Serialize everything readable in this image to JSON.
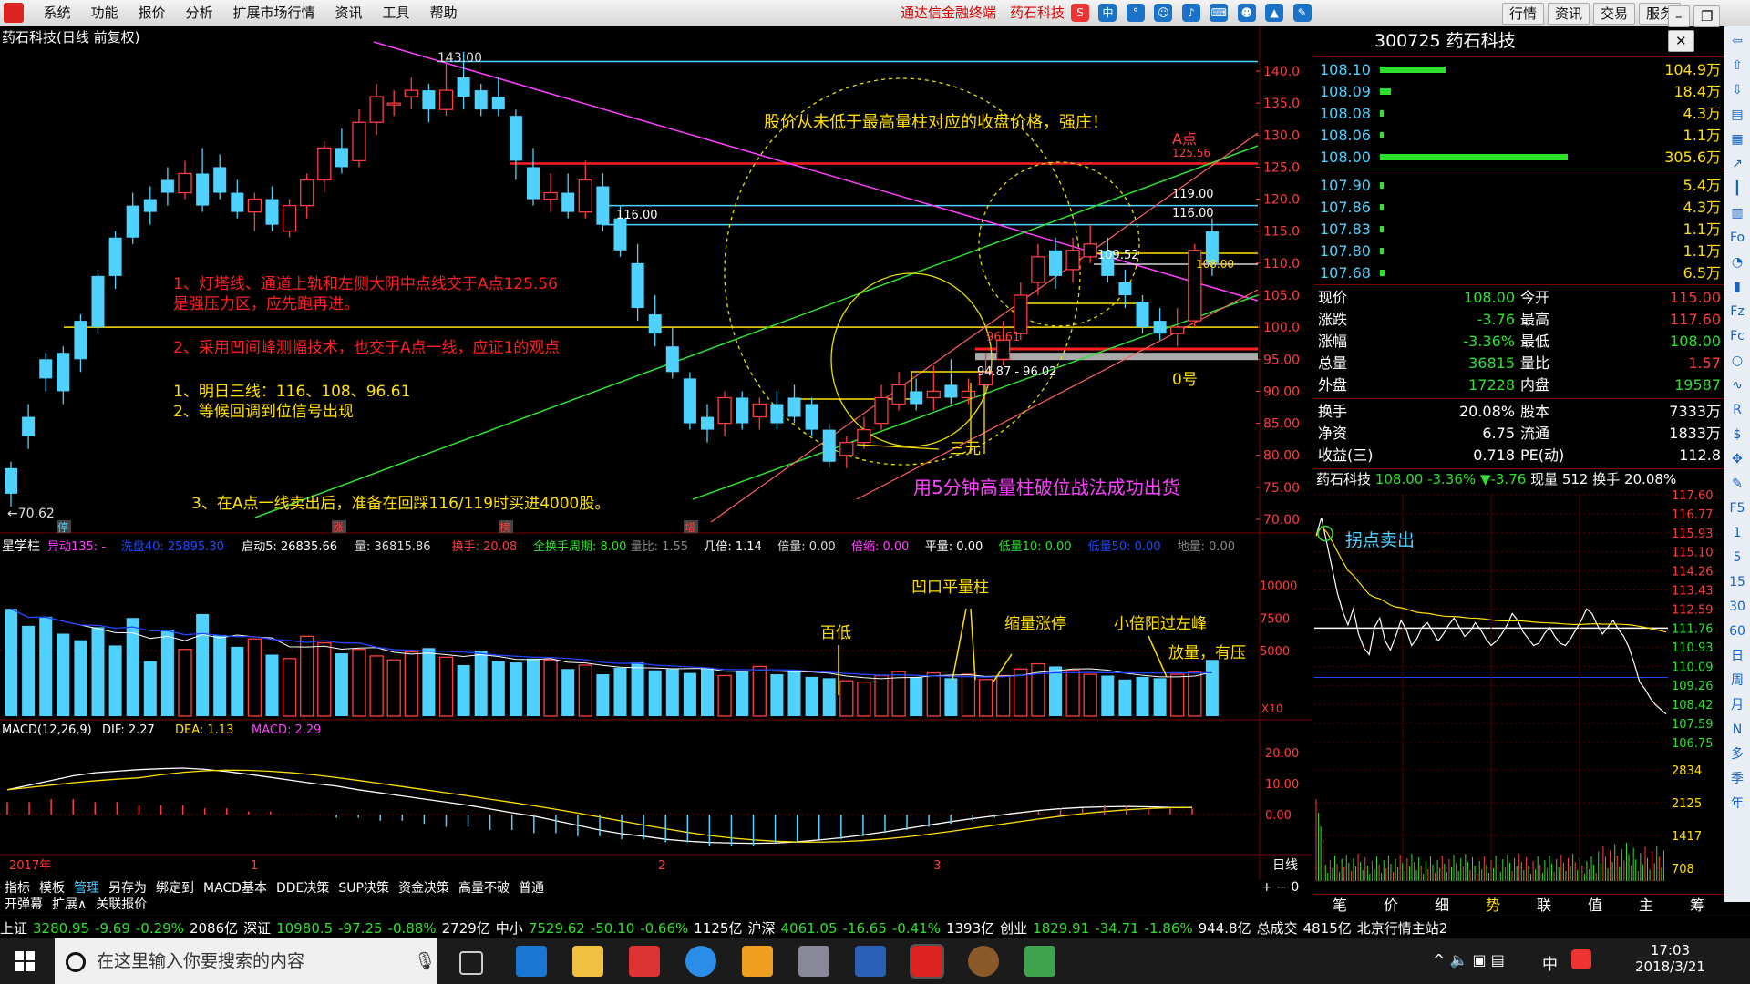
{
  "menu": {
    "items": [
      "系统",
      "功能",
      "报价",
      "分析",
      "扩展市场行情",
      "资讯",
      "工具",
      "帮助"
    ],
    "brand": "通达信金融终端",
    "stock_name": "药石科技",
    "right_buttons": [
      "行情",
      "资讯",
      "交易",
      "服务"
    ]
  },
  "chart": {
    "title": "药石科技(日线 前复权)",
    "price_axis": [
      "140.0",
      "135.0",
      "130.0",
      "125.0",
      "120.0",
      "115.0",
      "110.0",
      "105.0",
      "100.0",
      "95.00",
      "90.00",
      "85.00",
      "80.00",
      "75.00",
      "70.00"
    ],
    "high_label": "143.00",
    "low_label": "70.62",
    "level_116_left": "116.00",
    "level_a": "A点",
    "level_12556": "125.56",
    "level_119": "119.00",
    "level_116_right": "116.00",
    "level_10952": "109.52",
    "level_108": "108.00",
    "level_9661": "96.61",
    "range_label": "94.87 - 96.02",
    "label_zero": "0号",
    "label_sanyuan": "三元",
    "note_top": "股价从未低于最高量柱对应的收盘价格，强庄！",
    "note_red1a": "1、灯塔线、通道上轨和左侧大阴中点线交于A点125.56",
    "note_red1b": "是强压力区，应先跑再进。",
    "note_red2": "2、采用凹间峰测幅技术，也交于A点一线，应证1的观点",
    "note_y1": "1、明日三线：116、108、96.61",
    "note_y2": "2、等候回调到位信号出现",
    "note_y3": "3、在A点一线卖出后，准备在回踩116/119时买进4000股。",
    "note_magenta": "用5分钟高量柱破位战法成功出货",
    "marks": [
      "停",
      "涨",
      "榜",
      "增"
    ],
    "candles": [
      [
        1,
        78,
        74,
        72,
        79
      ],
      [
        2,
        86,
        83,
        81,
        88
      ],
      [
        3,
        95,
        92,
        90,
        96
      ],
      [
        4,
        96,
        90,
        88,
        97
      ],
      [
        5,
        101,
        95,
        93,
        102
      ],
      [
        6,
        108,
        100,
        99,
        109
      ],
      [
        7,
        114,
        108,
        106,
        115
      ],
      [
        8,
        119,
        114,
        113,
        121
      ],
      [
        9,
        120,
        118,
        116,
        122
      ],
      [
        10,
        123,
        121,
        119,
        125
      ],
      [
        11,
        121,
        124,
        120,
        126
      ],
      [
        12,
        124,
        119,
        118,
        128
      ],
      [
        13,
        125,
        121,
        120,
        127
      ],
      [
        14,
        121,
        118,
        117,
        123
      ],
      [
        15,
        118,
        120,
        115,
        121
      ],
      [
        16,
        120,
        116,
        115,
        122
      ],
      [
        17,
        115,
        119,
        114,
        120
      ],
      [
        18,
        119,
        123,
        117,
        124
      ],
      [
        19,
        123,
        128,
        121,
        129
      ],
      [
        20,
        128,
        125,
        124,
        131
      ],
      [
        21,
        126,
        132,
        125,
        134
      ],
      [
        22,
        132,
        136,
        130,
        138
      ],
      [
        23,
        135,
        135,
        133,
        137
      ],
      [
        24,
        136,
        137,
        134,
        139
      ],
      [
        25,
        137,
        134,
        132,
        138
      ],
      [
        26,
        134,
        137,
        133,
        142
      ],
      [
        27,
        139,
        136,
        134,
        143
      ],
      [
        28,
        137,
        134,
        133,
        138
      ],
      [
        29,
        136,
        134,
        133,
        139
      ],
      [
        30,
        133,
        126,
        123,
        134
      ],
      [
        31,
        125,
        120,
        119,
        128
      ],
      [
        32,
        120,
        121,
        118,
        124
      ],
      [
        33,
        121,
        118,
        117,
        124
      ],
      [
        34,
        118,
        123,
        117,
        126
      ],
      [
        35,
        122,
        116,
        115,
        124
      ],
      [
        36,
        117,
        112,
        111,
        119
      ],
      [
        37,
        110,
        103,
        101,
        113
      ],
      [
        38,
        102,
        99,
        97,
        105
      ],
      [
        39,
        97,
        93,
        92,
        100
      ],
      [
        40,
        92,
        85,
        84,
        93
      ],
      [
        41,
        86,
        84,
        82,
        88
      ],
      [
        42,
        85,
        89,
        83,
        90
      ],
      [
        43,
        89,
        85,
        84,
        90
      ],
      [
        44,
        86,
        88,
        84,
        89
      ],
      [
        45,
        88,
        85,
        84,
        90
      ],
      [
        46,
        89,
        86,
        85,
        91
      ],
      [
        47,
        88,
        84,
        83,
        89
      ],
      [
        48,
        84,
        79,
        78,
        85
      ],
      [
        49,
        80,
        82,
        78,
        83
      ],
      [
        50,
        82,
        84,
        81,
        86
      ],
      [
        51,
        85,
        89,
        84,
        91
      ],
      [
        52,
        88,
        91,
        87,
        93
      ],
      [
        53,
        90,
        88,
        87,
        92
      ],
      [
        54,
        89,
        90,
        87,
        94
      ],
      [
        55,
        91,
        89,
        88,
        95
      ],
      [
        56,
        89,
        90,
        88,
        92
      ],
      [
        57,
        91,
        93,
        90,
        96
      ],
      [
        58,
        95,
        98,
        94,
        101
      ],
      [
        59,
        99,
        105,
        98,
        107
      ],
      [
        60,
        107,
        111,
        105,
        113
      ],
      [
        61,
        112,
        108,
        106,
        114
      ],
      [
        62,
        109,
        112,
        107,
        114
      ],
      [
        63,
        111,
        113,
        110,
        116
      ],
      [
        64,
        112,
        108,
        107,
        114
      ],
      [
        65,
        107,
        105,
        103,
        109
      ],
      [
        66,
        104,
        100,
        99,
        105
      ],
      [
        67,
        101,
        99,
        98,
        103
      ],
      [
        68,
        99,
        100,
        97,
        103
      ],
      [
        69,
        101,
        112,
        100,
        113
      ],
      [
        70,
        115,
        110,
        108,
        117
      ]
    ]
  },
  "indicator_bar": {
    "name": "星学柱",
    "items": [
      {
        "t": "异动135: -",
        "c": "#ff40ff"
      },
      {
        "t": "洗盘40: 25895.30",
        "c": "#1e4bff"
      },
      {
        "t": "启动5: 26835.66",
        "c": "#fff"
      },
      {
        "t": "量: 36815.86",
        "c": "#ddd"
      },
      {
        "t": "换手: 20.08",
        "c": "#ff3d3d"
      },
      {
        "t": "全换手周期: 8.00",
        "c": "#2fe02f"
      },
      {
        "t": "量比: 1.55",
        "c": "#888"
      },
      {
        "t": "几倍: 1.14",
        "c": "#fff"
      },
      {
        "t": "倍量: 0.00",
        "c": "#ddd"
      },
      {
        "t": "倍缩: 0.00",
        "c": "#ff40ff"
      },
      {
        "t": "平量: 0.00",
        "c": "#fff"
      },
      {
        "t": "低量10: 0.00",
        "c": "#2fe02f"
      },
      {
        "t": "低量50: 0.00",
        "c": "#1e4bff"
      },
      {
        "t": "地量: 0.00",
        "c": "#888"
      }
    ],
    "vol_axis": [
      "10000",
      "7500",
      "5000"
    ],
    "x10": "X10",
    "vol_notes": [
      "百低",
      "凹口平量柱",
      "缩量涨停",
      "小倍阳过左峰",
      "放量，有压"
    ],
    "volumes": [
      8200,
      6900,
      7600,
      6300,
      5800,
      6800,
      5400,
      7500,
      4200,
      6600,
      5100,
      7800,
      6200,
      5300,
      5900,
      4700,
      4400,
      6100,
      5600,
      4800,
      5100,
      4600,
      4300,
      4900,
      5200,
      4500,
      3900,
      5000,
      4200,
      4100,
      4400,
      4300,
      3600,
      3900,
      3200,
      3700,
      4100,
      3500,
      3600,
      3300,
      3700,
      3100,
      3400,
      3800,
      3200,
      3500,
      3000,
      2900,
      2700,
      2600,
      3100,
      3400,
      3000,
      3300,
      2900,
      3200,
      2800,
      3100,
      3600,
      4000,
      3800,
      3500,
      3200,
      3100,
      2800,
      3000,
      2900,
      3200,
      3400,
      4300
    ]
  },
  "macd": {
    "label": "MACD(12,26,9)",
    "dif": "DIF: 2.27",
    "dea": "DEA: 1.13",
    "macd": "MACD: 2.29",
    "axis": [
      "20.00",
      "10.00",
      "0.00"
    ],
    "dif_series": [
      8,
      9.5,
      11,
      12.5,
      13.5,
      14,
      14.5,
      14.8,
      15,
      14.6,
      13.9,
      13,
      12,
      11,
      10,
      9.2,
      8,
      7,
      6,
      5,
      4,
      3,
      1.8,
      0.6,
      -0.5,
      -2,
      -3.5,
      -5,
      -6.2,
      -7,
      -8,
      -8.6,
      -9,
      -9.2,
      -9.3,
      -9.2,
      -8.8,
      -8.2,
      -7.5,
      -6.6,
      -5.6,
      -4.5,
      -3.4,
      -2.3,
      -1.3,
      -0.4,
      0.5,
      1.3,
      1.9,
      2.3,
      2.5,
      2.6,
      2.5,
      2.3,
      2.27
    ],
    "hist": [
      4,
      4,
      5,
      5,
      4,
      4,
      3,
      3,
      3,
      2,
      2,
      1,
      1,
      0,
      0,
      -1,
      -1,
      -2,
      -2,
      -3,
      -4,
      -4,
      -5,
      -5,
      -6,
      -6,
      -7,
      -7,
      -8,
      -8,
      -9,
      -9,
      -10,
      -10,
      -10,
      -9,
      -9,
      -8,
      -8,
      -7,
      -6,
      -5,
      -4,
      -3,
      -2,
      -1,
      0,
      1,
      2,
      2,
      3,
      3,
      2,
      2,
      2
    ]
  },
  "time_axis": [
    "2017年",
    "1",
    "2",
    "3"
  ],
  "period_label": "日线",
  "bottom_tabs": [
    "指标",
    "模板",
    "管理",
    "另存为",
    "绑定到",
    "MACD基本",
    "DDE决策",
    "SUP决策",
    "资金决策",
    "高量不破",
    "普通"
  ],
  "bottom_tabs2": [
    "开弹幕",
    "扩展∧",
    "关联报价"
  ],
  "quote": {
    "code": "300725",
    "name": "药石科技",
    "asks": [
      {
        "p": "108.10",
        "v": "104.9万",
        "w": 0.3
      },
      {
        "p": "108.09",
        "v": "18.4万",
        "w": 0.05
      },
      {
        "p": "108.08",
        "v": "4.3万",
        "w": 0.015
      },
      {
        "p": "108.06",
        "v": "1.1万",
        "w": 0.01
      },
      {
        "p": "108.00",
        "v": "305.6万",
        "w": 0.86
      }
    ],
    "bids": [
      {
        "p": "107.90",
        "v": "5.4万",
        "w": 0.015
      },
      {
        "p": "107.86",
        "v": "4.3万",
        "w": 0.015
      },
      {
        "p": "107.83",
        "v": "1.1万",
        "w": 0.01
      },
      {
        "p": "107.80",
        "v": "1.1万",
        "w": 0.01
      },
      {
        "p": "107.68",
        "v": "6.5万",
        "w": 0.02
      }
    ],
    "stats": [
      [
        "现价",
        "108.00",
        "今开",
        "115.00"
      ],
      [
        "涨跌",
        "-3.76",
        "最高",
        "117.60"
      ],
      [
        "涨幅",
        "-3.36%",
        "最低",
        "108.00"
      ],
      [
        "总量",
        "36815",
        "量比",
        "1.57"
      ],
      [
        "外盘",
        "17228",
        "内盘",
        "19587"
      ]
    ],
    "stats2": [
      [
        "换手",
        "20.08%",
        "股本",
        "7333万"
      ],
      [
        "净资",
        "6.75",
        "流通",
        "1833万"
      ],
      [
        "收益(三)",
        "0.718",
        "PE(动)",
        "112.8"
      ]
    ]
  },
  "intraday": {
    "header": "药石科技",
    "price": "108.00",
    "pct": "-3.36%",
    "chg": "▼-3.76",
    "vol": "现量 512",
    "turnover": "换手 20.08%",
    "note": "拐点卖出",
    "price_axis": [
      "117.60",
      "116.77",
      "115.93",
      "115.10",
      "114.26",
      "113.43",
      "112.59",
      "111.76",
      "110.93",
      "110.09",
      "109.26",
      "108.42",
      "107.59",
      "106.75"
    ],
    "vol_axis": [
      "2834",
      "2125",
      "1417",
      "708"
    ],
    "prices": [
      115.8,
      116.6,
      115.5,
      114.4,
      113.3,
      112.5,
      111.9,
      112.6,
      111.5,
      110.9,
      110.6,
      111.8,
      112.2,
      111.2,
      110.8,
      111.4,
      112.1,
      111.7,
      111.0,
      111.3,
      111.8,
      112.0,
      111.6,
      111.2,
      111.5,
      111.9,
      112.2,
      111.8,
      111.4,
      111.6,
      112.0,
      111.7,
      111.3,
      111.0,
      111.2,
      111.5,
      111.9,
      112.4,
      112.1,
      111.6,
      111.3,
      111.0,
      111.1,
      111.5,
      111.8,
      111.4,
      111.1,
      111.0,
      111.3,
      111.7,
      112.1,
      112.6,
      112.4,
      111.9,
      111.5,
      111.8,
      112.1,
      111.7,
      111.4,
      110.9,
      110.2,
      109.4,
      109.1,
      108.7,
      108.4,
      108.2,
      108.0
    ]
  },
  "right_tabs": [
    "笔",
    "价",
    "细",
    "势",
    "联",
    "值",
    "主",
    "筹"
  ],
  "index_bar": [
    {
      "t": "上证",
      "c": "#fff"
    },
    {
      "t": "3280.95",
      "c": "#2fe02f"
    },
    {
      "t": "-9.69",
      "c": "#2fe02f"
    },
    {
      "t": "-0.29%",
      "c": "#2fe02f"
    },
    {
      "t": "2086亿",
      "c": "#fff"
    },
    {
      "t": "深证",
      "c": "#fff"
    },
    {
      "t": "10980.5",
      "c": "#2fe02f"
    },
    {
      "t": "-97.25",
      "c": "#2fe02f"
    },
    {
      "t": "-0.88%",
      "c": "#2fe02f"
    },
    {
      "t": "2729亿",
      "c": "#fff"
    },
    {
      "t": "中小",
      "c": "#fff"
    },
    {
      "t": "7529.62",
      "c": "#2fe02f"
    },
    {
      "t": "-50.10",
      "c": "#2fe02f"
    },
    {
      "t": "-0.66%",
      "c": "#2fe02f"
    },
    {
      "t": "1125亿",
      "c": "#fff"
    },
    {
      "t": "沪深",
      "c": "#fff"
    },
    {
      "t": "4061.05",
      "c": "#2fe02f"
    },
    {
      "t": "-16.65",
      "c": "#2fe02f"
    },
    {
      "t": "-0.41%",
      "c": "#2fe02f"
    },
    {
      "t": "1393亿",
      "c": "#fff"
    },
    {
      "t": "创业",
      "c": "#fff"
    },
    {
      "t": "1829.91",
      "c": "#2fe02f"
    },
    {
      "t": "-34.71",
      "c": "#2fe02f"
    },
    {
      "t": "-1.86%",
      "c": "#2fe02f"
    },
    {
      "t": "944.8亿",
      "c": "#fff"
    },
    {
      "t": "总成交",
      "c": "#fff"
    },
    {
      "t": "4815亿",
      "c": "#fff"
    },
    {
      "t": "北京行情主站2",
      "c": "#fff"
    }
  ],
  "taskbar": {
    "search_placeholder": "在这里输入你要搜索的内容",
    "time": "17:03",
    "date": "2018/3/21",
    "ime": "中"
  },
  "colors": {
    "bg": "#000000",
    "up": "#ff3d3d",
    "down": "#4fd2ff",
    "grid": "#7a0000",
    "ma": "#ffe000",
    "trend_magenta": "#ff40ff",
    "trend_green": "#2fe02f"
  }
}
